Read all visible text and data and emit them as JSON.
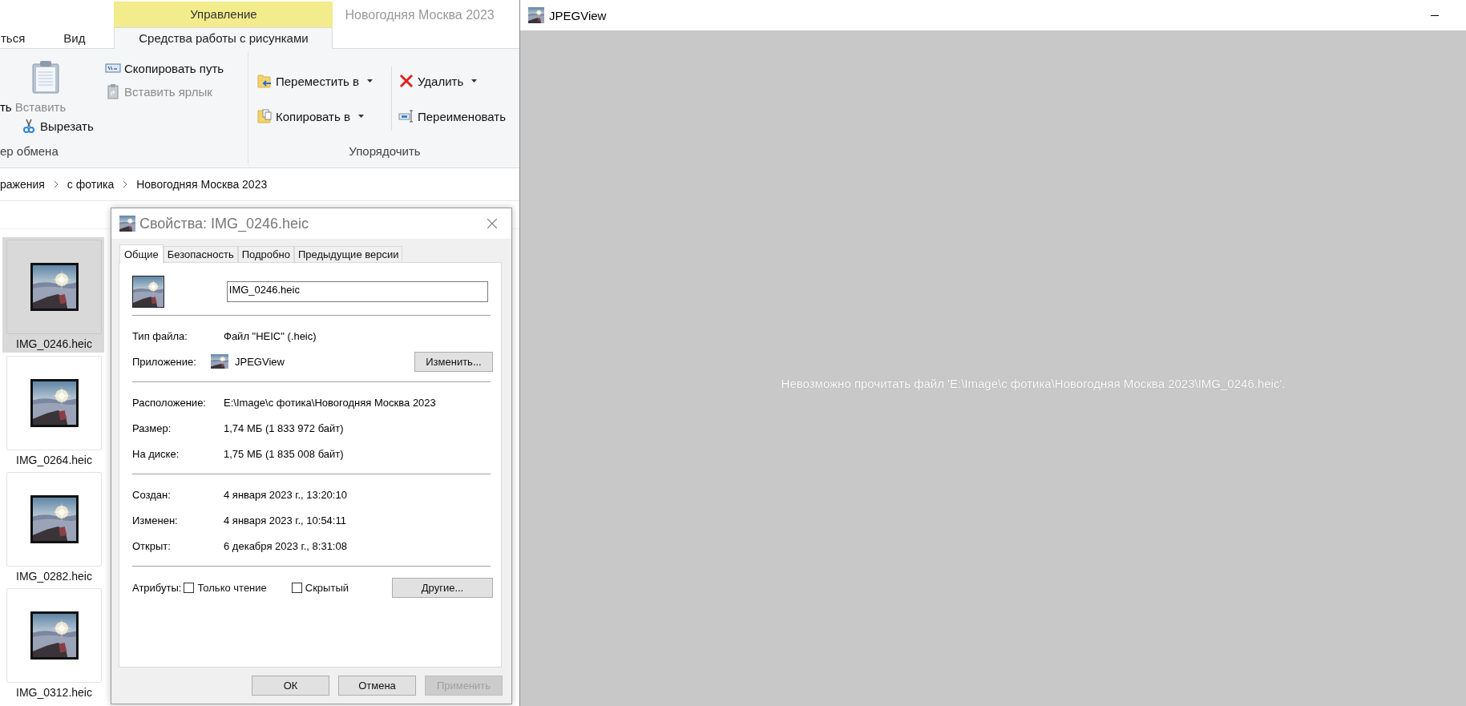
{
  "explorer": {
    "window_title": "Новогодняя Москва 2023",
    "context_group": "Управление",
    "tabs": [
      {
        "label": "ться",
        "selected": false
      },
      {
        "label": "Вид",
        "selected": false
      },
      {
        "label": "Средства работы с рисунками",
        "selected": true
      }
    ],
    "clipboard": {
      "label": "ер обмена",
      "items": [
        {
          "label": "ть",
          "kind": "fragment",
          "disabled": false
        },
        {
          "label": "Вставить",
          "kind": "large",
          "disabled": true
        },
        {
          "label": "Вырезать",
          "kind": "small",
          "disabled": false
        },
        {
          "label": "Скопировать путь",
          "kind": "small",
          "disabled": false
        },
        {
          "label": "Вставить ярлык",
          "kind": "small",
          "disabled": true
        }
      ]
    },
    "organize": {
      "label": "Упорядочить",
      "items": [
        {
          "label": "Переместить в",
          "kind": "dropdown",
          "disabled": false
        },
        {
          "label": "Удалить",
          "kind": "dropdown",
          "disabled": false
        },
        {
          "label": "Копировать в",
          "kind": "dropdown",
          "disabled": false
        },
        {
          "label": "Переименовать",
          "kind": "small",
          "disabled": false
        }
      ]
    },
    "breadcrumb": [
      "ражения",
      "с фотика",
      "Новогодняя Москва 2023"
    ],
    "files": [
      {
        "name": "IMG_0246.heic",
        "selected": true
      },
      {
        "name": "IMG_0264.heic",
        "selected": false
      },
      {
        "name": "IMG_0282.heic",
        "selected": false
      },
      {
        "name": "IMG_0312.heic",
        "selected": false
      }
    ]
  },
  "dialog": {
    "title": "Свойства: IMG_0246.heic",
    "tabs": [
      {
        "label": "Общие",
        "selected": true
      },
      {
        "label": "Безопасность",
        "selected": false
      },
      {
        "label": "Подробно",
        "selected": false
      },
      {
        "label": "Предыдущие версии",
        "selected": false
      }
    ],
    "file_name": "IMG_0246.heic",
    "sections": [
      [
        {
          "label": "Тип файла:",
          "value": "Файл \"HEIC\" (.heic)",
          "kind": "text"
        },
        {
          "label": "Приложение:",
          "value": "JPEGView",
          "kind": "app",
          "button": "Изменить..."
        }
      ],
      [
        {
          "label": "Расположение:",
          "value": "E:\\Image\\с фотика\\Новогодняя Москва 2023",
          "kind": "text"
        },
        {
          "label": "Размер:",
          "value": "1,74 МБ (1 833 972 байт)",
          "kind": "text"
        },
        {
          "label": "На диске:",
          "value": "1,75 МБ (1 835 008 байт)",
          "kind": "text"
        }
      ],
      [
        {
          "label": "Создан:",
          "value": "4 января 2023 г., 13:20:10",
          "kind": "text"
        },
        {
          "label": "Изменен:",
          "value": "4 января 2023 г., 10:54:11",
          "kind": "text"
        },
        {
          "label": "Открыт:",
          "value": "6 декабря 2023 г., 8:31:08",
          "kind": "text"
        }
      ]
    ],
    "attributes": {
      "label": "Атрибуты:",
      "checkboxes": [
        {
          "label": "Только чтение",
          "checked": false
        },
        {
          "label": "Скрытый",
          "checked": false
        }
      ],
      "button": "Другие..."
    },
    "buttons": [
      {
        "label": "ОК",
        "disabled": false
      },
      {
        "label": "Отмена",
        "disabled": false
      },
      {
        "label": "Применить",
        "disabled": true
      }
    ]
  },
  "viewer": {
    "title": "JPEGView",
    "message": "Невозможно прочитать файл 'E:\\Image\\с фотика\\Новогодняя Москва 2023\\IMG_0246.heic'."
  }
}
